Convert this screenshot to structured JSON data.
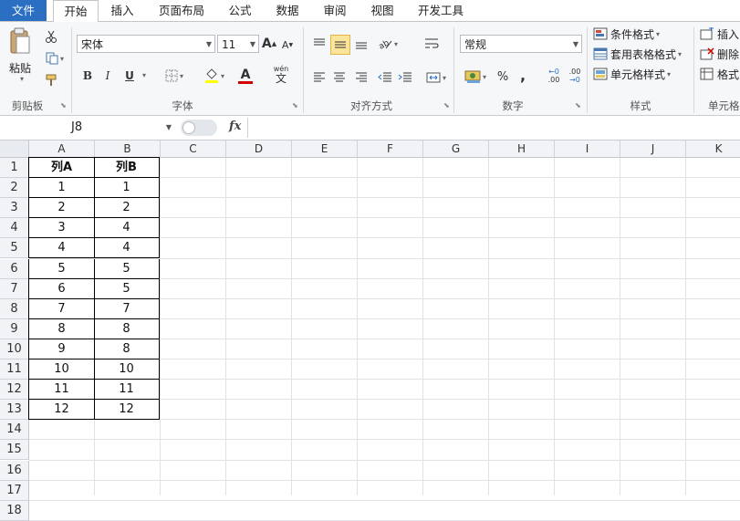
{
  "tabs": [
    "文件",
    "开始",
    "插入",
    "页面布局",
    "公式",
    "数据",
    "审阅",
    "视图",
    "开发工具"
  ],
  "clipboard": {
    "paste": "粘贴",
    "label": "剪贴板"
  },
  "font": {
    "name": "宋体",
    "size": "11",
    "bold": "B",
    "italic": "I",
    "underline": "U",
    "label": "字体",
    "grow": "A",
    "shrink": "A",
    "phonetic": "wén",
    "phonetic2": "文",
    "color_letter": "A"
  },
  "alignment": {
    "label": "对齐方式"
  },
  "number": {
    "format": "常规",
    "percent": "%",
    "comma": ",",
    "inc_decimal": ".00",
    "dec_decimal": ".00",
    "label": "数字"
  },
  "styles": {
    "conditional": "条件格式",
    "table": "套用表格格式",
    "cell": "单元格样式",
    "label": "样式"
  },
  "cells": {
    "insert": "插入",
    "delete": "删除",
    "format": "格式",
    "label": "单元格"
  },
  "formula_bar": {
    "name_box": "J8",
    "fx": "fx",
    "formula": ""
  },
  "columns": [
    "A",
    "B",
    "C",
    "D",
    "E",
    "F",
    "G",
    "H",
    "I",
    "J",
    "K"
  ],
  "rows": [
    "1",
    "2",
    "3",
    "4",
    "5",
    "6",
    "7",
    "8",
    "9",
    "10",
    "11",
    "12",
    "13",
    "14",
    "15",
    "16",
    "17",
    "18"
  ],
  "table": {
    "headers": [
      "列A",
      "列B"
    ],
    "rows": [
      [
        "1",
        "1"
      ],
      [
        "2",
        "2"
      ],
      [
        "3",
        "4"
      ],
      [
        "4",
        "4"
      ],
      [
        "5",
        "5"
      ],
      [
        "6",
        "5"
      ],
      [
        "7",
        "7"
      ],
      [
        "8",
        "8"
      ],
      [
        "9",
        "8"
      ],
      [
        "10",
        "10"
      ],
      [
        "11",
        "11"
      ],
      [
        "12",
        "12"
      ]
    ]
  },
  "colors": {
    "file_tab": "#2a6fc2",
    "font_color": "#d00000",
    "fill_color": "#ffff00",
    "highlight": "#fbe59b"
  }
}
